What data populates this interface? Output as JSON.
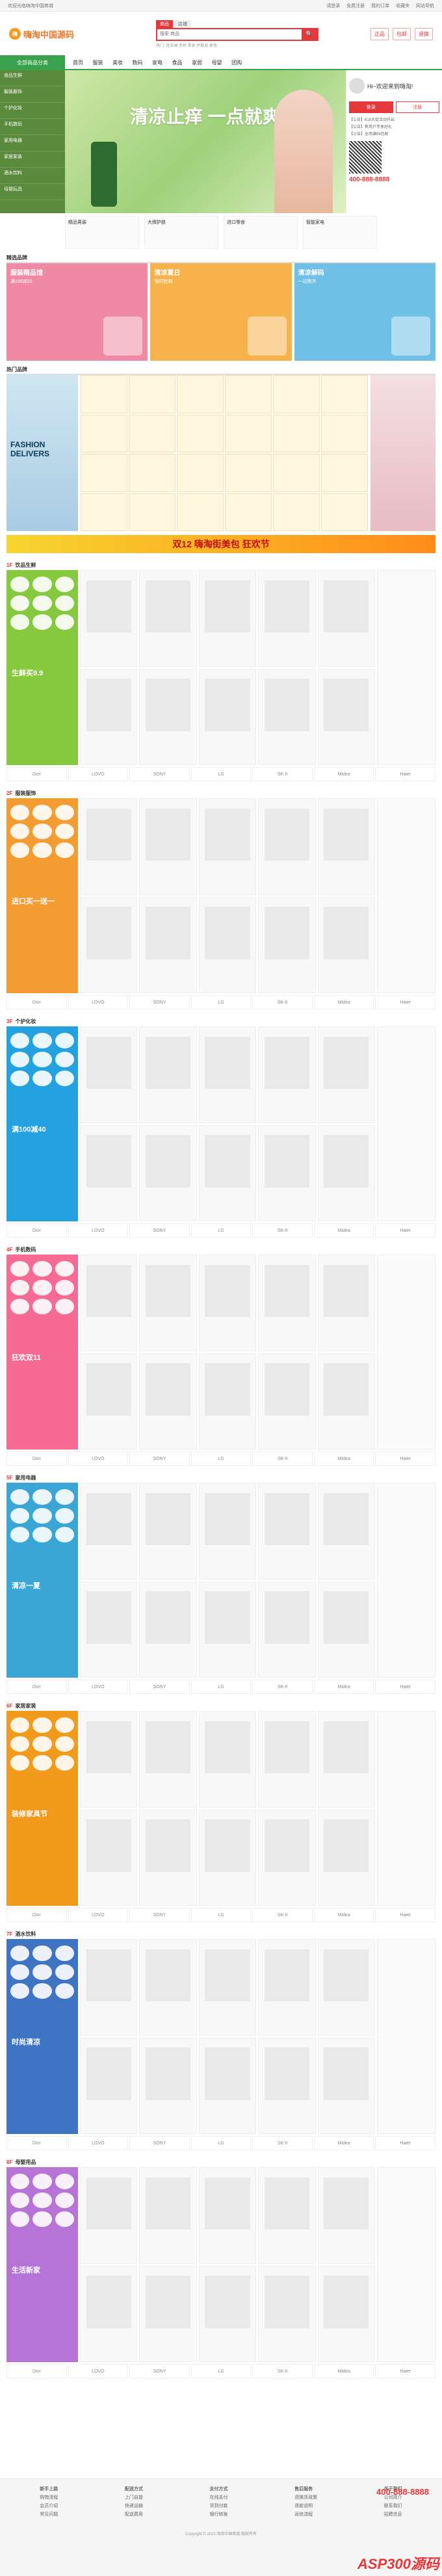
{
  "topbar": {
    "greeting": "欢迎光临嗨淘中国商城",
    "links": [
      "请登录",
      "免费注册",
      "我的订单",
      "收藏夹",
      "网站导航"
    ]
  },
  "header": {
    "logo_badge": "嗨",
    "logo_text": "嗨淘中国源码",
    "search_tabs": [
      "商品",
      "店铺"
    ],
    "search_placeholder": "搜索 商品",
    "search_button": "🔍",
    "hotwords": "热门: 连衣裙 手机 零食 护肤品 家电",
    "promos": [
      "正品",
      "包邮",
      "退换"
    ]
  },
  "nav": {
    "category_label": "全部商品分类",
    "items": [
      "首页",
      "服装",
      "美妆",
      "数码",
      "家电",
      "食品",
      "家居",
      "母婴",
      "团购"
    ]
  },
  "side_menu": [
    "食品生鲜",
    "服装服饰",
    "个护化妆",
    "手机数码",
    "家用电器",
    "家居家装",
    "酒水饮料",
    "母婴玩具"
  ],
  "banner": {
    "slogan": "清凉止痒 一点就爽"
  },
  "right_panel": {
    "user": "Hi~欢迎来到嗨淘!",
    "login": "登录",
    "register": "注册",
    "news": [
      "【公告】618大促活动开启",
      "【公告】新用户专享好礼",
      "【公告】全场满99包邮"
    ],
    "phone": "400-888-8888"
  },
  "sub_hero": [
    "精品男装",
    "大牌护肤",
    "进口零食",
    "智能家电"
  ],
  "sections": {
    "jingxuan": "精选品牌",
    "jingxuan_cards": [
      {
        "t1": "服装精品馆",
        "t2": "满199减50"
      },
      {
        "t1": "清凉夏日",
        "t2": "限时抢购"
      },
      {
        "t1": "清凉解码",
        "t2": "一站购齐"
      }
    ],
    "hot": "热门品牌",
    "hot_left_text": "FASHION DELIVERS"
  },
  "ad_strip": "双12 嗨淘街美包 狂欢节",
  "floors": [
    {
      "num": "1F",
      "name": "饮品生鲜",
      "promo": "生鲜买9.9",
      "color": "#86c93f"
    },
    {
      "num": "2F",
      "name": "服装服饰",
      "promo": "进口买一送一",
      "color": "#f39c32"
    },
    {
      "num": "3F",
      "name": "个护化妆",
      "promo": "满100减40",
      "color": "#23a1e0"
    },
    {
      "num": "4F",
      "name": "手机数码",
      "promo": "狂欢双11",
      "color": "#f56b93"
    },
    {
      "num": "5F",
      "name": "家用电器",
      "promo": "清凉一夏",
      "color": "#3aa6d6"
    },
    {
      "num": "6F",
      "name": "家居家装",
      "promo": "装修家具节",
      "color": "#f29a1b"
    },
    {
      "num": "7F",
      "name": "酒水饮料",
      "promo": "时尚清凉",
      "color": "#3f74c4"
    },
    {
      "num": "8F",
      "name": "母婴用品",
      "promo": "生活新家",
      "color": "#b574d6"
    }
  ],
  "brands": [
    "Dior",
    "LOVO",
    "SONY",
    "LG",
    "SK-II",
    "Midea",
    "Haier"
  ],
  "footer": {
    "cols": [
      {
        "title": "新手上路",
        "items": [
          "购物流程",
          "会员介绍",
          "常见问题"
        ]
      },
      {
        "title": "配送方式",
        "items": [
          "上门自提",
          "快递运输",
          "配送费用"
        ]
      },
      {
        "title": "支付方式",
        "items": [
          "在线支付",
          "货到付款",
          "银行转账"
        ]
      },
      {
        "title": "售后服务",
        "items": [
          "退换货政策",
          "退款说明",
          "返修流程"
        ]
      },
      {
        "title": "关于我们",
        "items": [
          "公司简介",
          "联系我们",
          "招聘信息"
        ]
      }
    ],
    "tel": "400-888-8888",
    "copyright": "Copyright © 2015 嗨淘中国商城 版权所有"
  },
  "watermark": "ASP300源码"
}
